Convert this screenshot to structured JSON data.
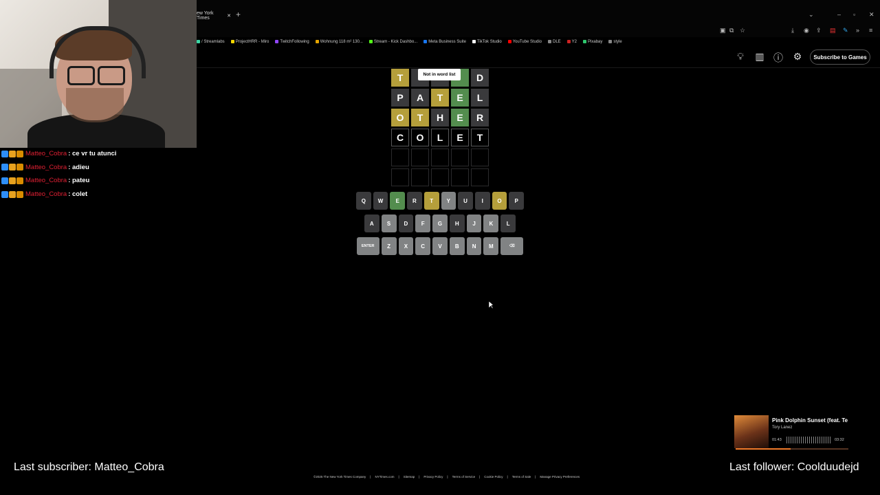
{
  "browser": {
    "tab_title": "ew York Times",
    "new_tab_icon": "+",
    "bookmarks": [
      {
        "label": "/ Streamlabs",
        "color": "#3ad6a4"
      },
      {
        "label": "ProjectHRR - Miro",
        "color": "#f2d600"
      },
      {
        "label": "TwitchFollowing",
        "color": "#9146ff"
      },
      {
        "label": "Wohnung 118 m² 130...",
        "color": "#e5a500"
      },
      {
        "label": "Stream - Kick Dashbo...",
        "color": "#53fc18"
      },
      {
        "label": "Meta Business Suite",
        "color": "#1877f2"
      },
      {
        "label": "TikTok Studio",
        "color": "#ffffff"
      },
      {
        "label": "YouTube Studio",
        "color": "#ff0000"
      },
      {
        "label": "DLE",
        "color": "#888888"
      },
      {
        "label": "Y2",
        "color": "#cc2222"
      },
      {
        "label": "Pixabay",
        "color": "#2ec66d"
      },
      {
        "label": "style",
        "color": "#888888"
      }
    ]
  },
  "header": {
    "subscribe_label": "Subscribe to Games"
  },
  "chat": [
    {
      "user": "Matteo_Cobra",
      "message": ": ce vr tu atunci"
    },
    {
      "user": "Matteo_Cobra",
      "message": ": adieu"
    },
    {
      "user": "Matteo_Cobra",
      "message": ": pateu"
    },
    {
      "user": "Matteo_Cobra",
      "message": ": colet"
    }
  ],
  "toast": "Not in word list",
  "board": [
    [
      {
        "l": "T",
        "s": "present"
      },
      {
        "l": "",
        "s": "absent"
      },
      {
        "l": "",
        "s": "absent"
      },
      {
        "l": "",
        "s": "correct"
      },
      {
        "l": "D",
        "s": "absent"
      }
    ],
    [
      {
        "l": "P",
        "s": "absent"
      },
      {
        "l": "A",
        "s": "absent"
      },
      {
        "l": "T",
        "s": "present"
      },
      {
        "l": "E",
        "s": "correct"
      },
      {
        "l": "L",
        "s": "absent"
      }
    ],
    [
      {
        "l": "O",
        "s": "present"
      },
      {
        "l": "T",
        "s": "present"
      },
      {
        "l": "H",
        "s": "absent"
      },
      {
        "l": "E",
        "s": "correct"
      },
      {
        "l": "R",
        "s": "absent"
      }
    ],
    [
      {
        "l": "C",
        "s": "tbd"
      },
      {
        "l": "O",
        "s": "tbd"
      },
      {
        "l": "L",
        "s": "tbd"
      },
      {
        "l": "E",
        "s": "tbd"
      },
      {
        "l": "T",
        "s": "tbd"
      }
    ],
    [
      {
        "l": "",
        "s": "empty"
      },
      {
        "l": "",
        "s": "empty"
      },
      {
        "l": "",
        "s": "empty"
      },
      {
        "l": "",
        "s": "empty"
      },
      {
        "l": "",
        "s": "empty"
      }
    ],
    [
      {
        "l": "",
        "s": "empty"
      },
      {
        "l": "",
        "s": "empty"
      },
      {
        "l": "",
        "s": "empty"
      },
      {
        "l": "",
        "s": "empty"
      },
      {
        "l": "",
        "s": "empty"
      }
    ]
  ],
  "keyboard": [
    [
      {
        "k": "Q",
        "s": "absent"
      },
      {
        "k": "W",
        "s": "absent"
      },
      {
        "k": "E",
        "s": "correct"
      },
      {
        "k": "R",
        "s": "absent"
      },
      {
        "k": "T",
        "s": "present"
      },
      {
        "k": "Y",
        "s": "unused"
      },
      {
        "k": "U",
        "s": "absent"
      },
      {
        "k": "I",
        "s": "absent"
      },
      {
        "k": "O",
        "s": "present"
      },
      {
        "k": "P",
        "s": "absent"
      }
    ],
    [
      {
        "k": "A",
        "s": "absent"
      },
      {
        "k": "S",
        "s": "unused"
      },
      {
        "k": "D",
        "s": "absent"
      },
      {
        "k": "F",
        "s": "unused"
      },
      {
        "k": "G",
        "s": "unused"
      },
      {
        "k": "H",
        "s": "absent"
      },
      {
        "k": "J",
        "s": "unused"
      },
      {
        "k": "K",
        "s": "unused"
      },
      {
        "k": "L",
        "s": "absent"
      }
    ],
    [
      {
        "k": "ENTER",
        "s": "unused",
        "wide": true
      },
      {
        "k": "Z",
        "s": "unused"
      },
      {
        "k": "X",
        "s": "unused"
      },
      {
        "k": "C",
        "s": "unused"
      },
      {
        "k": "V",
        "s": "unused"
      },
      {
        "k": "B",
        "s": "unused"
      },
      {
        "k": "N",
        "s": "unused"
      },
      {
        "k": "M",
        "s": "unused"
      },
      {
        "k": "⌫",
        "s": "unused",
        "wide": true
      }
    ]
  ],
  "music": {
    "title": "Pink Dolphin Sunset (feat. Te",
    "artist": "Tory Lanez",
    "time_current": "01:43",
    "time_total": "03:32",
    "progress": 0.49
  },
  "overlay": {
    "last_subscriber": "Last subscriber: Matteo_Cobra",
    "last_follower": "Last follower: Coolduudejd"
  },
  "footer_links": [
    "©2025 The New York Times Company",
    "NYTimes.com",
    "Sitemap",
    "Privacy Policy",
    "Terms of Service",
    "Cookie Policy",
    "Terms of Sale",
    "Manage Privacy Preferences"
  ],
  "colors": {
    "correct": "#538d4e",
    "present": "#b59f3b",
    "absent": "#3a3a3c",
    "key_default": "#818384",
    "chat_user": "#e02033"
  }
}
